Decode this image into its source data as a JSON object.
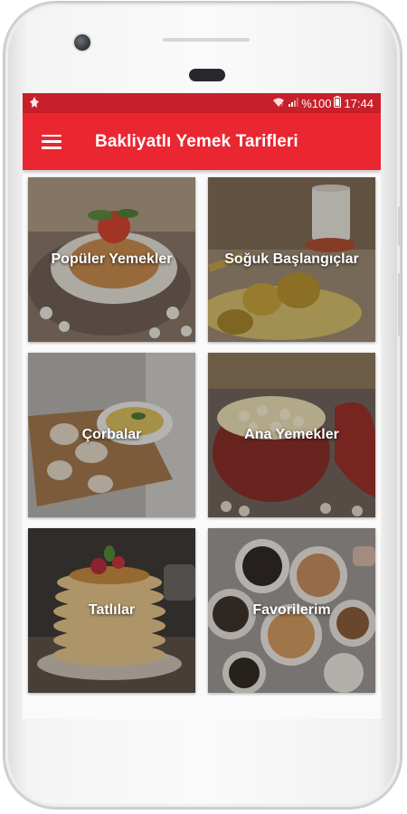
{
  "status_bar": {
    "battery": "%100",
    "time": "17:44"
  },
  "app_bar": {
    "title": "Bakliyatlı Yemek Tarifleri"
  },
  "categories": [
    {
      "label": "Popüler Yemekler"
    },
    {
      "label": "Soğuk Başlangıçlar"
    },
    {
      "label": "Çorbalar"
    },
    {
      "label": "Ana Yemekler"
    },
    {
      "label": "Tatlılar"
    },
    {
      "label": "Favorilerim"
    }
  ],
  "colors": {
    "status_bar": "#c7202a",
    "app_bar": "#ea2631",
    "background": "#fafafa"
  },
  "icons": [
    "menu-icon",
    "notification-icon",
    "wifi-icon",
    "signal-icon",
    "battery-icon"
  ]
}
